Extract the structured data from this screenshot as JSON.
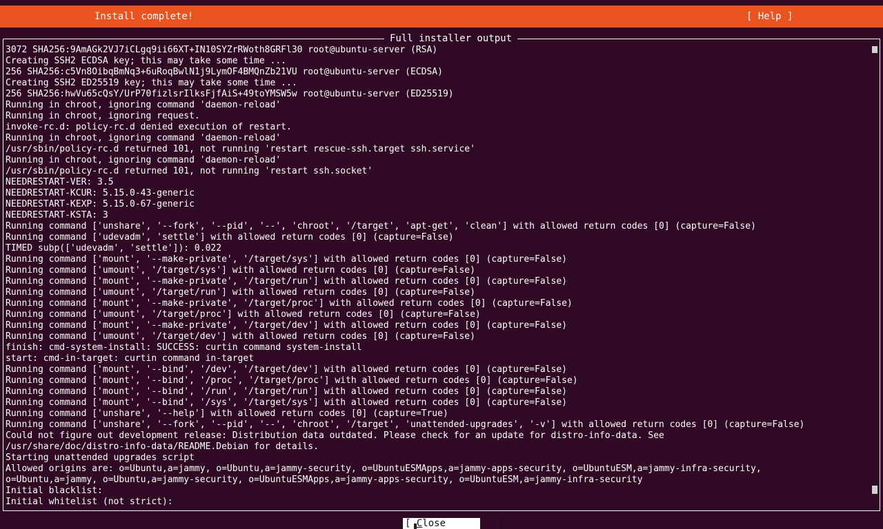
{
  "header": {
    "title": "Install complete!",
    "help_label": "[ Help ]"
  },
  "panel": {
    "title": "Full installer output",
    "lines": [
      "3072 SHA256:9AmAGk2VJ7iCLgq9ii66XT+IN10SYZrRWoth8GRFl30 root@ubuntu-server (RSA)",
      "Creating SSH2 ECDSA key; this may take some time ...",
      "256 SHA256:c5Vn8OibqBmNq3+6uRoqBwlN1j9LymOF4BMQnZb21VU root@ubuntu-server (ECDSA)",
      "Creating SSH2 ED25519 key; this may take some time ...",
      "256 SHA256:hwVu65cQsY/UrP70fizlsrIlksFjfAiS+49toYMSW5w root@ubuntu-server (ED25519)",
      "Running in chroot, ignoring command 'daemon-reload'",
      "Running in chroot, ignoring request.",
      "invoke-rc.d: policy-rc.d denied execution of restart.",
      "Running in chroot, ignoring command 'daemon-reload'",
      "/usr/sbin/policy-rc.d returned 101, not running 'restart rescue-ssh.target ssh.service'",
      "Running in chroot, ignoring command 'daemon-reload'",
      "/usr/sbin/policy-rc.d returned 101, not running 'restart ssh.socket'",
      "NEEDRESTART-VER: 3.5",
      "NEEDRESTART-KCUR: 5.15.0-43-generic",
      "NEEDRESTART-KEXP: 5.15.0-67-generic",
      "NEEDRESTART-KSTA: 3",
      "Running command ['unshare', '--fork', '--pid', '--', 'chroot', '/target', 'apt-get', 'clean'] with allowed return codes [0] (capture=False)",
      "Running command ['udevadm', 'settle'] with allowed return codes [0] (capture=False)",
      "TIMED subp(['udevadm', 'settle']): 0.022",
      "Running command ['mount', '--make-private', '/target/sys'] with allowed return codes [0] (capture=False)",
      "Running command ['umount', '/target/sys'] with allowed return codes [0] (capture=False)",
      "Running command ['mount', '--make-private', '/target/run'] with allowed return codes [0] (capture=False)",
      "Running command ['umount', '/target/run'] with allowed return codes [0] (capture=False)",
      "Running command ['mount', '--make-private', '/target/proc'] with allowed return codes [0] (capture=False)",
      "Running command ['umount', '/target/proc'] with allowed return codes [0] (capture=False)",
      "Running command ['mount', '--make-private', '/target/dev'] with allowed return codes [0] (capture=False)",
      "Running command ['umount', '/target/dev'] with allowed return codes [0] (capture=False)",
      "finish: cmd-system-install: SUCCESS: curtin command system-install",
      "start: cmd-in-target: curtin command in-target",
      "Running command ['mount', '--bind', '/dev', '/target/dev'] with allowed return codes [0] (capture=False)",
      "Running command ['mount', '--bind', '/proc', '/target/proc'] with allowed return codes [0] (capture=False)",
      "Running command ['mount', '--bind', '/run', '/target/run'] with allowed return codes [0] (capture=False)",
      "Running command ['mount', '--bind', '/sys', '/target/sys'] with allowed return codes [0] (capture=False)",
      "Running command ['unshare', '--help'] with allowed return codes [0] (capture=True)",
      "Running command ['unshare', '--fork', '--pid', '--', 'chroot', '/target', 'unattended-upgrades', '-v'] with allowed return codes [0] (capture=False)",
      "Could not figure out development release: Distribution data outdated. Please check for an update for distro-info-data. See",
      "/usr/share/doc/distro-info-data/README.Debian for details.",
      "Starting unattended upgrades script",
      "Allowed origins are: o=Ubuntu,a=jammy, o=Ubuntu,a=jammy-security, o=UbuntuESMApps,a=jammy-apps-security, o=UbuntuESM,a=jammy-infra-security,",
      "o=Ubuntu,a=jammy, o=Ubuntu,a=jammy-security, o=UbuntuESMApps,a=jammy-apps-security, o=UbuntuESM,a=jammy-infra-security",
      "Initial blacklist:",
      "Initial whitelist (not strict):"
    ]
  },
  "footer": {
    "close_open": "[ ",
    "close_hotkey": "C",
    "close_rest": "lose",
    "close_end": "         ]"
  },
  "colors": {
    "header_background": "#e95420",
    "screen_background": "#300a24",
    "text": "#ffffff"
  }
}
